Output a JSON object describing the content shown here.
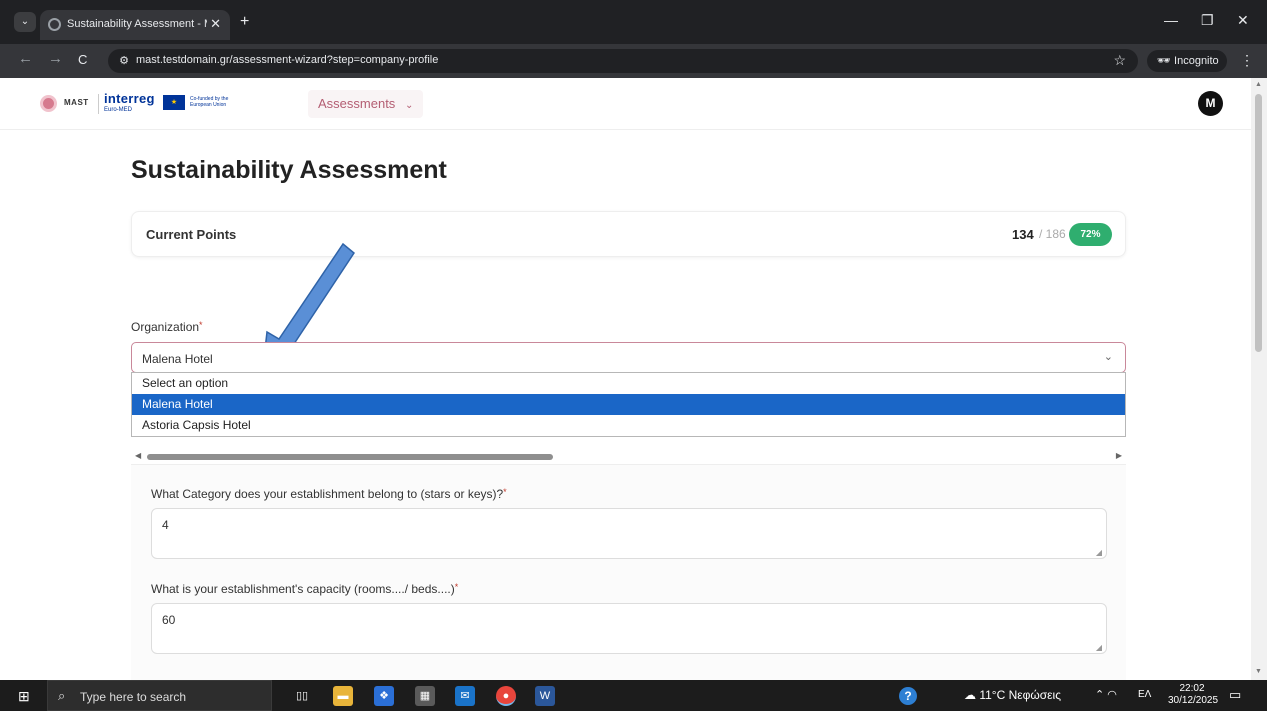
{
  "browser": {
    "tab_title": "Sustainability Assessment - MA",
    "tab_menu_glyph": "⌄",
    "tab_close_glyph": "✕",
    "new_tab_glyph": "+",
    "url": "mast.testdomain.gr/assessment-wizard?step=company-profile",
    "incognito_label": "Incognito",
    "window_controls": {
      "minimize": "—",
      "restore": "❐",
      "close": "✕"
    },
    "nav": {
      "back": "←",
      "forward": "→",
      "reload": "C"
    }
  },
  "header": {
    "brand_mast": "MAST",
    "brand_interreg": "interreg",
    "brand_euromed": "Euro-MED",
    "brand_eu": "Co-funded by the European Union",
    "nav_assessments": "Assessments",
    "avatar_initial": "M"
  },
  "main": {
    "title": "Sustainability Assessment",
    "points": {
      "label": "Current Points",
      "current": "134",
      "total_text": "/ 186",
      "percent": "72%"
    },
    "organization": {
      "label": "Organization",
      "required_mark": "*",
      "selected": "Malena Hotel",
      "options": [
        "Select an option",
        "Malena Hotel",
        "Astoria Capsis Hotel"
      ]
    },
    "questions": [
      {
        "label": "What Category does your establishment belong to (stars or keys)?",
        "value": "4"
      },
      {
        "label": "What is your establishment's capacity (rooms..../ beds....)",
        "value": "60"
      }
    ]
  },
  "taskbar": {
    "search_placeholder": "Type here to search",
    "weather": "11°C Νεφώσεις",
    "language": "ΕΛ",
    "time": "22:02",
    "date": "30/12/2025"
  },
  "colors": {
    "accent": "#b45e73",
    "badge_green": "#2fae6f",
    "option_selected": "#1a66c7",
    "arrow": "#5a8fd6"
  }
}
